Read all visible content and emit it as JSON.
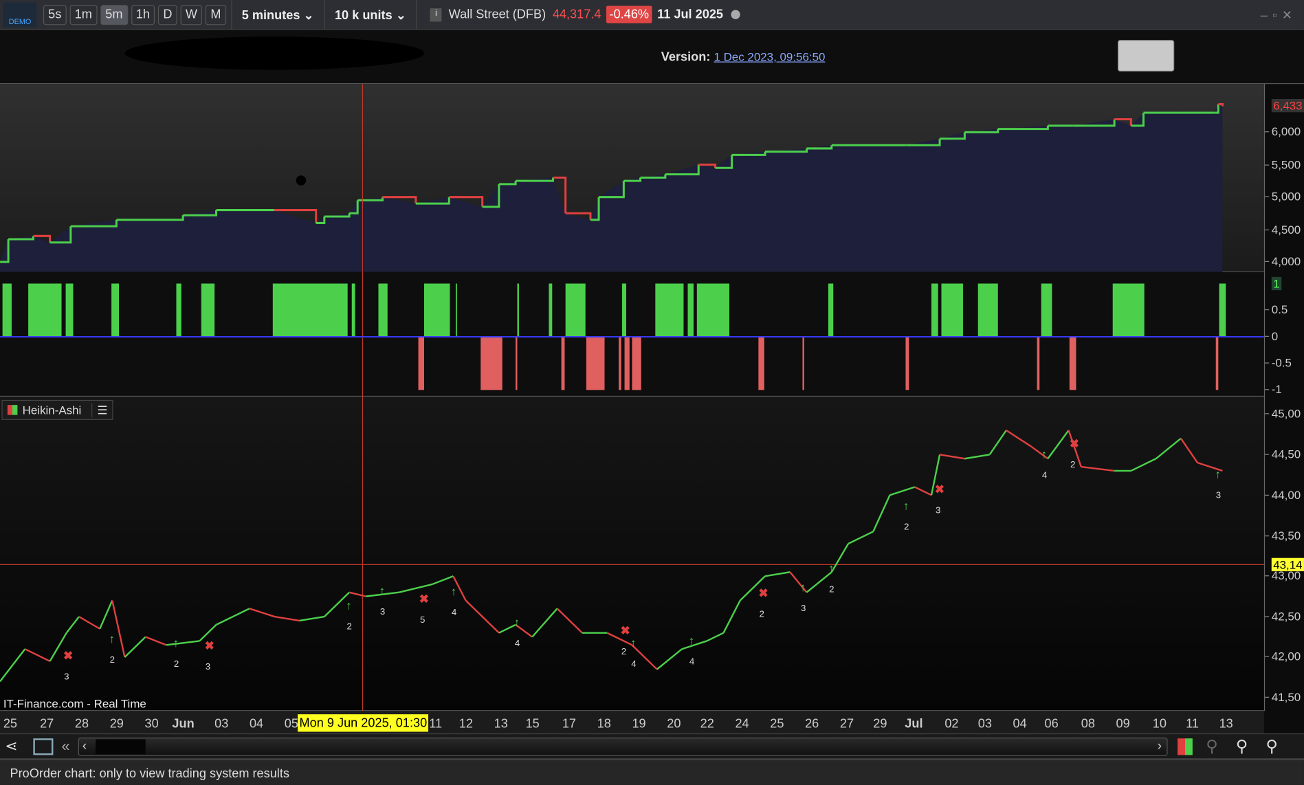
{
  "toolbar": {
    "badge": "DEMO",
    "periods": [
      "5s",
      "1m",
      "5m",
      "1h",
      "D",
      "W",
      "M"
    ],
    "active_period": "5m",
    "timeframe": "5 minutes",
    "units": "10 k units",
    "instrument": "Wall Street (DFB)",
    "price": "44,317.4",
    "change": "-0.46%",
    "date": "11 Jul 2025"
  },
  "header": {
    "version_label": "Version:",
    "version_link": "1 Dec 2023, 09:56:50"
  },
  "equity_axis": {
    "ticks": [
      "6,000",
      "5,500",
      "5,000",
      "4,500",
      "4,000"
    ],
    "current": "6,433"
  },
  "hist_axis": {
    "ticks": [
      "0.5",
      "0",
      "-0.5",
      "-1"
    ],
    "current": "1"
  },
  "price_axis": {
    "ticks": [
      "45,00",
      "44,50",
      "44,00",
      "43,50",
      "43,00",
      "42,50",
      "42,00",
      "41,50"
    ],
    "crosshair": "43,14"
  },
  "price_panel": {
    "legend": "Heikin-Ashi",
    "watermark": "IT-Finance.com - Real Time"
  },
  "time_axis": {
    "labels": [
      "25",
      "27",
      "28",
      "29",
      "30",
      "Jun",
      "03",
      "04",
      "05",
      "11",
      "12",
      "13",
      "15",
      "17",
      "18",
      "19",
      "20",
      "22",
      "24",
      "25",
      "26",
      "27",
      "29",
      "Jul",
      "02",
      "03",
      "04",
      "06",
      "08",
      "09",
      "10",
      "11",
      "13"
    ],
    "crosshair": "Mon 9 Jun 2025, 01:30"
  },
  "status": {
    "text": "ProOrder chart: only to view trading system results"
  },
  "colors": {
    "up": "#4cd04c",
    "down": "#e04040",
    "equity_fill": "#1e1f3a",
    "crosshair": "#c0392b",
    "zero_line": "#3a3aff"
  },
  "chart_data": [
    {
      "type": "area",
      "title": "Equity",
      "x_range": [
        0,
        1470
      ],
      "ylim": [
        4000,
        6433
      ],
      "x": [
        0,
        10,
        40,
        60,
        85,
        140,
        215,
        220,
        260,
        330,
        380,
        390,
        420,
        430,
        460,
        500,
        540,
        580,
        600,
        620,
        665,
        680,
        710,
        720,
        750,
        770,
        800,
        840,
        860,
        880,
        920,
        970,
        1000,
        1090,
        1130,
        1160,
        1200,
        1260,
        1290,
        1340,
        1360,
        1375,
        1460,
        1465,
        1470
      ],
      "y": [
        4000,
        4350,
        4400,
        4300,
        4550,
        4650,
        4650,
        4720,
        4800,
        4800,
        4600,
        4700,
        4750,
        4950,
        5000,
        4900,
        5000,
        4850,
        5200,
        5250,
        5300,
        4750,
        4650,
        5000,
        5250,
        5300,
        5350,
        5500,
        5450,
        5650,
        5700,
        5750,
        5800,
        5800,
        5900,
        6000,
        6050,
        6100,
        6100,
        6200,
        6100,
        6300,
        6300,
        6433,
        6400
      ]
    },
    {
      "type": "bar",
      "title": "Position indicator",
      "ylim": [
        -1,
        1
      ],
      "segments": [
        [
          3,
          14,
          1
        ],
        [
          34,
          74,
          1
        ],
        [
          79,
          88,
          1
        ],
        [
          134,
          143,
          1
        ],
        [
          212,
          218,
          1
        ],
        [
          242,
          258,
          1
        ],
        [
          328,
          418,
          1
        ],
        [
          423,
          427,
          1
        ],
        [
          455,
          466,
          1
        ],
        [
          510,
          541,
          1
        ],
        [
          548,
          549,
          1
        ],
        [
          622,
          624,
          1
        ],
        [
          660,
          664,
          1
        ],
        [
          680,
          704,
          1
        ],
        [
          748,
          753,
          1
        ],
        [
          788,
          822,
          1
        ],
        [
          827,
          834,
          1
        ],
        [
          838,
          877,
          1
        ],
        [
          996,
          1002,
          1
        ],
        [
          1120,
          1128,
          1
        ],
        [
          1132,
          1158,
          1
        ],
        [
          1176,
          1200,
          1
        ],
        [
          1252,
          1265,
          1
        ],
        [
          1338,
          1376,
          1
        ],
        [
          1466,
          1474,
          1
        ],
        [
          503,
          510,
          -1
        ],
        [
          578,
          604,
          -1
        ],
        [
          620,
          622,
          -1
        ],
        [
          675,
          679,
          -1
        ],
        [
          705,
          727,
          -1
        ],
        [
          744,
          747,
          -1
        ],
        [
          751,
          757,
          -1
        ],
        [
          760,
          771,
          -1
        ],
        [
          912,
          919,
          -1
        ],
        [
          965,
          967,
          -1
        ],
        [
          1089,
          1093,
          -1
        ],
        [
          1247,
          1250,
          -1
        ],
        [
          1286,
          1294,
          -1
        ],
        [
          1462,
          1465,
          -1
        ]
      ]
    },
    {
      "type": "line",
      "title": "Heikin-Ashi",
      "ylim": [
        41500,
        45000
      ],
      "x": [
        0,
        30,
        60,
        80,
        95,
        120,
        135,
        150,
        175,
        200,
        240,
        260,
        300,
        330,
        360,
        390,
        420,
        440,
        480,
        520,
        545,
        560,
        600,
        620,
        640,
        670,
        700,
        730,
        760,
        790,
        820,
        850,
        870,
        890,
        920,
        950,
        970,
        1000,
        1020,
        1050,
        1070,
        1100,
        1120,
        1130,
        1160,
        1190,
        1210,
        1240,
        1260,
        1285,
        1300,
        1340,
        1360,
        1390,
        1420,
        1440,
        1470
      ],
      "y": [
        41700,
        42100,
        41950,
        42300,
        42500,
        42350,
        42700,
        42000,
        42250,
        42150,
        42200,
        42400,
        42600,
        42500,
        42450,
        42500,
        42800,
        42750,
        42800,
        42900,
        43000,
        42700,
        42300,
        42400,
        42250,
        42600,
        42300,
        42300,
        42150,
        41850,
        42100,
        42200,
        42300,
        42700,
        43000,
        43050,
        42800,
        43050,
        43400,
        43550,
        44000,
        44100,
        44000,
        44500,
        44450,
        44500,
        44800,
        44600,
        44450,
        44800,
        44350,
        44300,
        44300,
        44450,
        44700,
        44400,
        44300
      ]
    },
    {
      "type": "scatter",
      "title": "Signals",
      "labels": [
        "3",
        "2",
        "2",
        "3",
        "2",
        "3",
        "5",
        "4",
        "4",
        "2",
        "4",
        "4",
        "3",
        "2",
        "2",
        "2",
        "3",
        "4",
        "2",
        "3"
      ]
    }
  ]
}
